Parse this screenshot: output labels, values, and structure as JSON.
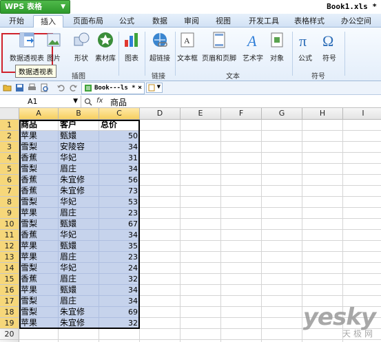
{
  "app": {
    "name": "WPS 表格",
    "doc_title": "Book1.xls *"
  },
  "tabs": [
    "开始",
    "插入",
    "页面布局",
    "公式",
    "数据",
    "审阅",
    "视图",
    "开发工具",
    "表格样式",
    "办公空间"
  ],
  "ribbon": {
    "buttons": [
      {
        "label": "数据透视表",
        "icon": "pivot-table-icon"
      },
      {
        "label": "图片",
        "icon": "picture-icon"
      },
      {
        "label": "形状",
        "icon": "shapes-icon"
      },
      {
        "label": "素材库",
        "icon": "clipart-icon"
      },
      {
        "label": "图表",
        "icon": "chart-icon"
      },
      {
        "label": "超链接",
        "icon": "hyperlink-icon"
      },
      {
        "label": "文本框",
        "icon": "textbox-icon"
      },
      {
        "label": "页眉和页脚",
        "icon": "header-footer-icon"
      },
      {
        "label": "艺术字",
        "icon": "wordart-icon"
      },
      {
        "label": "对象",
        "icon": "object-icon"
      },
      {
        "label": "公式",
        "icon": "formula-icon"
      },
      {
        "label": "符号",
        "icon": "symbol-icon"
      }
    ],
    "groups": [
      "插图",
      "链接",
      "文本",
      "符号"
    ],
    "tooltip": "数据透视表"
  },
  "quickbar": {
    "doc_tab": "Book---ls *"
  },
  "formula_bar": {
    "name_box": "A1",
    "fx": "fx",
    "content": "商品"
  },
  "columns": [
    "A",
    "B",
    "C",
    "D",
    "E",
    "F",
    "G",
    "H",
    "I"
  ],
  "rows": [
    "1",
    "2",
    "3",
    "4",
    "5",
    "6",
    "7",
    "8",
    "9",
    "10",
    "11",
    "12",
    "13",
    "14",
    "15",
    "16",
    "17",
    "18",
    "19",
    "20",
    "21"
  ],
  "table": {
    "headers": [
      "商品",
      "客户",
      "总价"
    ],
    "data": [
      [
        "苹果",
        "甄嬛",
        "50"
      ],
      [
        "雪梨",
        "安陵容",
        "34"
      ],
      [
        "香蕉",
        "华妃",
        "31"
      ],
      [
        "雪梨",
        "眉庄",
        "34"
      ],
      [
        "香蕉",
        "朱宜修",
        "56"
      ],
      [
        "香蕉",
        "朱宜修",
        "73"
      ],
      [
        "雪梨",
        "华妃",
        "53"
      ],
      [
        "苹果",
        "眉庄",
        "23"
      ],
      [
        "雪梨",
        "甄嬛",
        "67"
      ],
      [
        "香蕉",
        "华妃",
        "34"
      ],
      [
        "苹果",
        "甄嬛",
        "35"
      ],
      [
        "苹果",
        "眉庄",
        "23"
      ],
      [
        "雪梨",
        "华妃",
        "24"
      ],
      [
        "香蕉",
        "眉庄",
        "32"
      ],
      [
        "苹果",
        "甄嬛",
        "34"
      ],
      [
        "雪梨",
        "眉庄",
        "34"
      ],
      [
        "雪梨",
        "朱宜修",
        "69"
      ],
      [
        "苹果",
        "朱宜修",
        "32"
      ]
    ]
  },
  "watermark": {
    "brand": "yesky",
    "sub": "天极网"
  },
  "colors": {
    "selection": "#c6d3ec",
    "accent_green": "#2e9a2c",
    "highlight_red": "#d0202a"
  }
}
